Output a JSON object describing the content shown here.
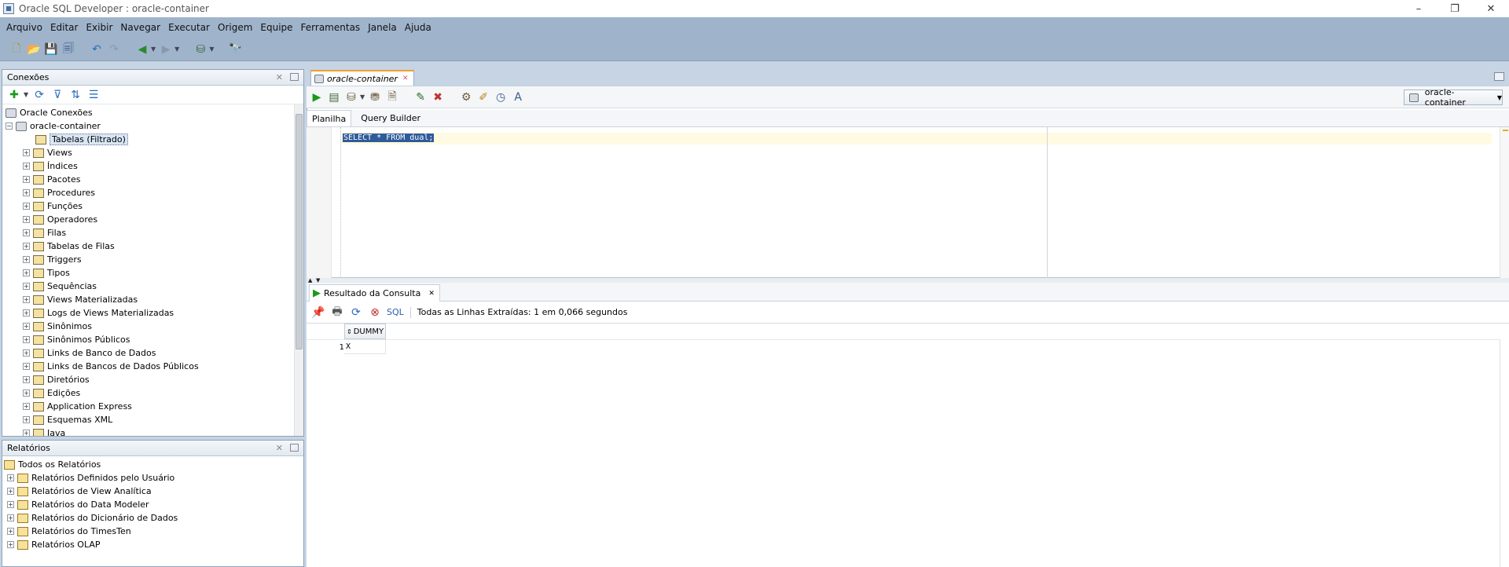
{
  "window": {
    "title": "Oracle SQL Developer : oracle-container"
  },
  "menu": [
    "Arquivo",
    "Editar",
    "Exibir",
    "Navegar",
    "Executar",
    "Origem",
    "Equipe",
    "Ferramentas",
    "Janela",
    "Ajuda"
  ],
  "connections_panel": {
    "title": "Conexões",
    "root": "Oracle Conexões",
    "connection": "oracle-container",
    "items": [
      "Tabelas (Filtrado)",
      "Views",
      "Índices",
      "Pacotes",
      "Procedures",
      "Funções",
      "Operadores",
      "Filas",
      "Tabelas de Filas",
      "Triggers",
      "Tipos",
      "Sequências",
      "Views Materializadas",
      "Logs de Views Materializadas",
      "Sinônimos",
      "Sinônimos Públicos",
      "Links de Banco de Dados",
      "Links de Bancos de Dados Públicos",
      "Diretórios",
      "Edições",
      "Application Express",
      "Esquemas XML",
      "Java"
    ]
  },
  "reports_panel": {
    "title": "Relatórios",
    "root": "Todos os Relatórios",
    "items": [
      "Relatórios Definidos pelo Usuário",
      "Relatórios de View Analítica",
      "Relatórios do Data Modeler",
      "Relatórios do Dicionário de Dados",
      "Relatórios do TimesTen",
      "Relatórios OLAP"
    ]
  },
  "editor": {
    "tab": "oracle-container",
    "connection_select": "oracle-container",
    "sub_tabs": [
      "Planilha",
      "Query Builder"
    ],
    "code": "SELECT * FROM dual;"
  },
  "results": {
    "tab": "Resultado da Consulta",
    "sql_link": "SQL",
    "status": "Todas as Linhas Extraídas: 1 em 0,066 segundos",
    "columns": [
      "DUMMY"
    ],
    "rows": [
      [
        "1",
        "X"
      ]
    ]
  },
  "colors": {
    "chrome": "#9fb4cb",
    "selection": "#2e5b9a",
    "tab_accent": "#f0a030"
  }
}
